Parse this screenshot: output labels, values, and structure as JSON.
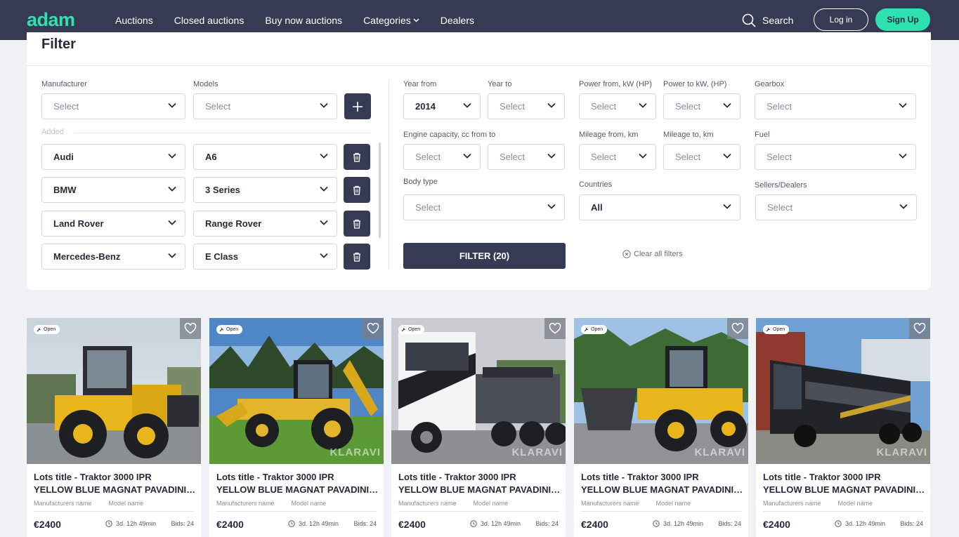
{
  "nav": {
    "logo": "adam",
    "links": [
      "Auctions",
      "Closed auctions",
      "Buy now auctions",
      "Categories",
      "Dealers"
    ],
    "search": "Search",
    "login": "Log in",
    "signup": "Sign Up"
  },
  "filter": {
    "title": "Filter",
    "manufacturer_label": "Manufacturer",
    "models_label": "Models",
    "placeholder": "Select",
    "added_label": "Added",
    "added": [
      {
        "make": "Audi",
        "model": "A6"
      },
      {
        "make": "BMW",
        "model": "3 Series"
      },
      {
        "make": "Land Rover",
        "model": "Range Rover"
      },
      {
        "make": "Mercedes-Benz",
        "model": "E Class"
      }
    ],
    "year_from_label": "Year from",
    "year_from_value": "2014",
    "year_to_label": "Year to",
    "power_from_label": "Power from, kW (HP)",
    "power_to_label": "Power to kW, (HP)",
    "gearbox_label": "Gearbox",
    "engine_label": "Engine capacity, cc from to",
    "mileage_from_label": "Mileage from, km",
    "mileage_to_label": "Mileage to, km",
    "fuel_label": "Fuel",
    "body_label": "Body type",
    "countries_label": "Countries",
    "countries_value": "All",
    "sellers_label": "Sellers/Dealers",
    "filter_button": "FILTER (20)",
    "clear": "Clear all filters"
  },
  "cards": [
    {
      "badge": "Open",
      "title1": "Lots title - Traktor 3000 IPR",
      "title2": "YELLOW BLUE MAGNAT PAVADINIMAS",
      "manufacturer": "Manufacturers name",
      "model": "Model name",
      "price": "€2400",
      "time": "3d. 12h 49min",
      "bids": "Bids: 24",
      "watermark": ""
    },
    {
      "badge": "Open",
      "title1": "Lots title - Traktor 3000 IPR",
      "title2": "YELLOW BLUE MAGNAT PAVADINIMAS",
      "manufacturer": "Manufacturers name",
      "model": "Model name",
      "price": "€2400",
      "time": "3d. 12h 49min",
      "bids": "Bids: 24",
      "watermark": "KLARAVI"
    },
    {
      "badge": "Open",
      "title1": "Lots title - Traktor 3000 IPR",
      "title2": "YELLOW BLUE MAGNAT PAVADINIMAS",
      "manufacturer": "Manufacturers name",
      "model": "Model name",
      "price": "€2400",
      "time": "3d. 12h 49min",
      "bids": "Bids: 24",
      "watermark": "KLARAVI"
    },
    {
      "badge": "Open",
      "title1": "Lots title - Traktor 3000 IPR",
      "title2": "YELLOW BLUE MAGNAT PAVADINIMAS",
      "manufacturer": "Manufacturers name",
      "model": "Model name",
      "price": "€2400",
      "time": "3d. 12h 49min",
      "bids": "Bids: 24",
      "watermark": "KLARAVI"
    },
    {
      "badge": "Open",
      "title1": "Lots title - Traktor 3000 IPR",
      "title2": "YELLOW BLUE MAGNAT PAVADINIMAS",
      "manufacturer": "Manufacturers name",
      "model": "Model name",
      "price": "€2400",
      "time": "3d. 12h 49min",
      "bids": "Bids: 24",
      "watermark": "KLARAVI"
    }
  ],
  "colors": {
    "nav_bg": "#363a53",
    "accent": "#2fe0b0",
    "dark_button": "#363a53"
  }
}
